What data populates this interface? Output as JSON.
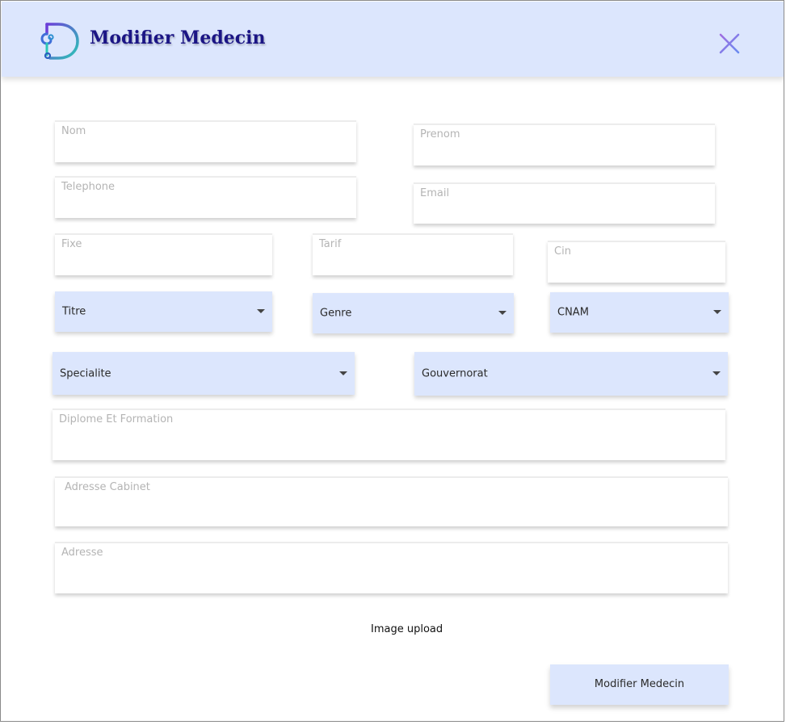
{
  "header": {
    "title": "Modifier Medecin",
    "logo_icon": "stethoscope-d-logo",
    "close_icon": "close-icon",
    "background_color": "#dce6fd",
    "title_color": "#1b1585"
  },
  "form": {
    "nom": {
      "placeholder": "Nom",
      "value": ""
    },
    "prenom": {
      "placeholder": "Prenom",
      "value": ""
    },
    "telephone": {
      "placeholder": "Telephone",
      "value": ""
    },
    "email": {
      "placeholder": "Email",
      "value": ""
    },
    "fixe": {
      "placeholder": "Fixe",
      "value": ""
    },
    "tarif": {
      "placeholder": "Tarif",
      "value": ""
    },
    "cin": {
      "placeholder": "Cin",
      "value": ""
    },
    "titre": {
      "label": "Titre"
    },
    "genre": {
      "label": "Genre"
    },
    "cnam": {
      "label": "CNAM"
    },
    "specialite": {
      "label": "Specialite"
    },
    "gouvernorat": {
      "label": "Gouvernorat"
    },
    "diplome": {
      "placeholder": "Diplome Et Formation",
      "value": ""
    },
    "adresse_cabinet": {
      "placeholder": "Adresse Cabinet",
      "value": ""
    },
    "adresse": {
      "placeholder": "Adresse",
      "value": ""
    },
    "image_upload_label": "Image upload",
    "submit_label": "Modifier Medecin"
  }
}
